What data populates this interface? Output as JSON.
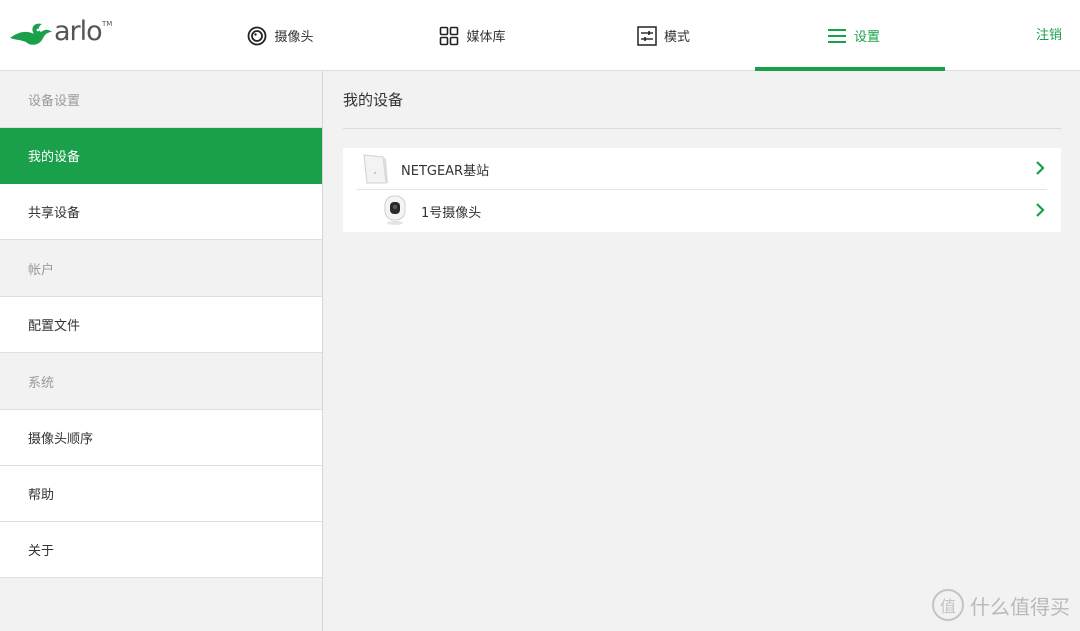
{
  "brand": {
    "logo_text": "arlo",
    "trademark": "TM"
  },
  "nav": {
    "items": [
      {
        "label": "摄像头",
        "icon": "camera-ring-icon"
      },
      {
        "label": "媒体库",
        "icon": "grid-icon"
      },
      {
        "label": "模式",
        "icon": "sliders-icon"
      },
      {
        "label": "设置",
        "icon": "menu-icon",
        "active": true
      }
    ],
    "logout": "注销"
  },
  "sidebar": {
    "sections": [
      {
        "title": "设备设置",
        "items": [
          "我的设备",
          "共享设备"
        ]
      },
      {
        "title": "帐户",
        "items": [
          "配置文件"
        ]
      },
      {
        "title": "系统",
        "items": [
          "摄像头顺序",
          "帮助",
          "关于"
        ]
      }
    ],
    "active_item": "我的设备"
  },
  "main": {
    "title": "我的设备",
    "devices": [
      {
        "name": "NETGEAR基站",
        "icon": "base-station-icon"
      },
      {
        "name": "1号摄像头",
        "icon": "camera-device-icon"
      }
    ]
  },
  "watermark": {
    "text": "什么值得买",
    "icon_char": "值"
  },
  "colors": {
    "accent": "#1a9f4a",
    "background": "#f2f2f2"
  }
}
